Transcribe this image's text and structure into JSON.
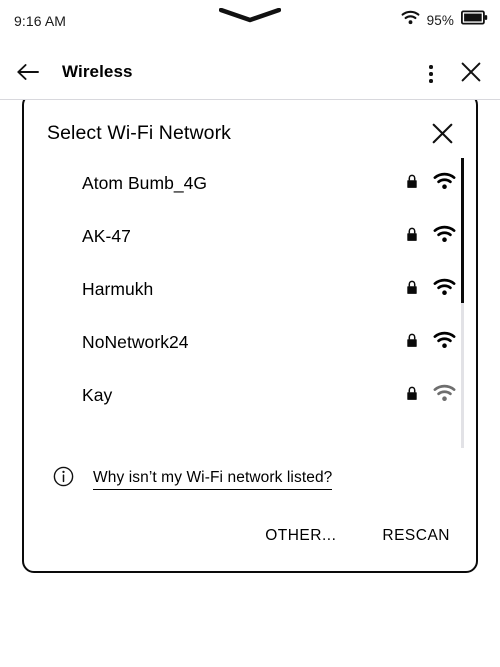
{
  "status_bar": {
    "time": "9:16 AM",
    "wifi_icon": "wifi-icon",
    "battery_percent": "95%",
    "battery_icon": "battery-full-icon",
    "notch_icon": "chevron-down-handle-icon"
  },
  "header": {
    "back_icon": "arrow-left-icon",
    "title": "Wireless",
    "overflow_icon": "more-vertical-icon",
    "close_icon": "close-icon"
  },
  "dialog": {
    "title": "Select Wi-Fi Network",
    "close_icon": "close-icon",
    "networks": [
      {
        "name": "Atom Bumb_4G",
        "secured": true,
        "lock_icon": "lock-icon",
        "signal_icon": "wifi-signal-icon",
        "signal_strength": "strong",
        "signal_color": "#000000"
      },
      {
        "name": "AK-47",
        "secured": true,
        "lock_icon": "lock-icon",
        "signal_icon": "wifi-signal-icon",
        "signal_strength": "strong",
        "signal_color": "#000000"
      },
      {
        "name": "Harmukh",
        "secured": true,
        "lock_icon": "lock-icon",
        "signal_icon": "wifi-signal-icon",
        "signal_strength": "strong",
        "signal_color": "#000000"
      },
      {
        "name": "NoNetwork24",
        "secured": true,
        "lock_icon": "lock-icon",
        "signal_icon": "wifi-signal-icon",
        "signal_strength": "strong",
        "signal_color": "#000000"
      },
      {
        "name": "Kay",
        "secured": true,
        "lock_icon": "lock-icon",
        "signal_icon": "wifi-signal-icon",
        "signal_strength": "weak",
        "signal_color": "#6e6e6e"
      }
    ],
    "help": {
      "info_icon": "info-circle-icon",
      "text": "Why isn’t my Wi-Fi network listed?"
    },
    "actions": {
      "other_label": "OTHER...",
      "rescan_label": "RESCAN"
    }
  },
  "colors": {
    "background": "#ffffff",
    "foreground": "#000000",
    "divider": "#d8d8dd",
    "scrollbar_thumb": "#0a0a0a",
    "scrollbar_track": "#e2e2e6",
    "muted_icon": "#6e6e6e"
  }
}
